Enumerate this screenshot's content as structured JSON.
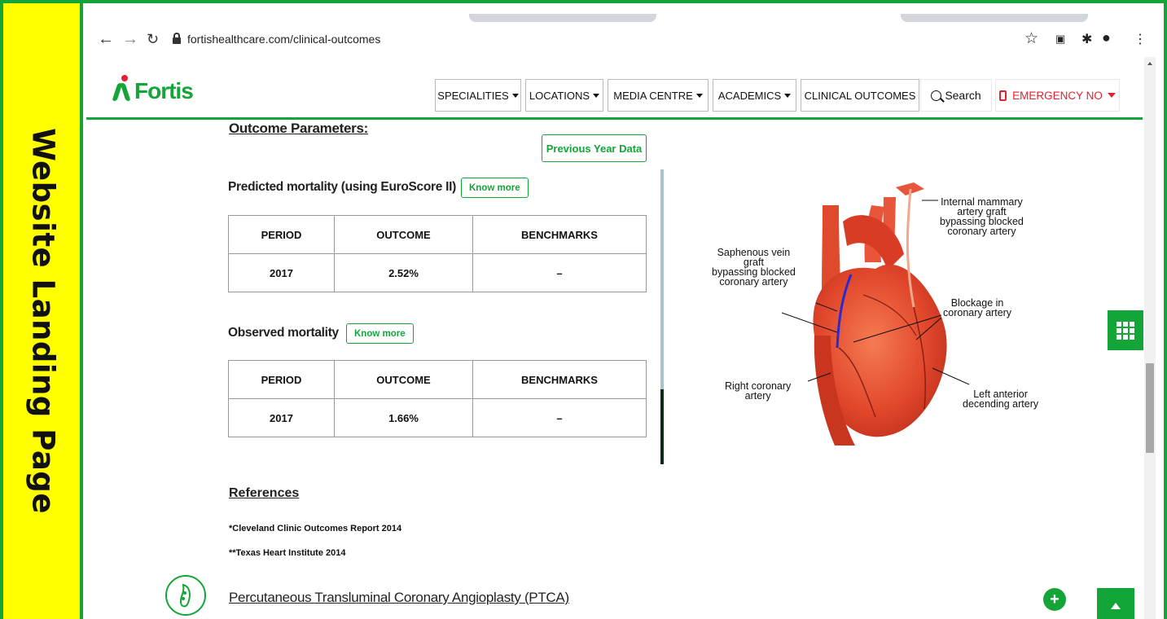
{
  "side_banner": {
    "text": "Website Landing Page"
  },
  "browser": {
    "url": "fortishealthcare.com/clinical-outcomes",
    "icons": [
      "back-arrow-icon",
      "forward-arrow-icon",
      "reload-icon",
      "lock-icon",
      "star-icon",
      "extension-icon",
      "puzzle-icon",
      "profile-icon",
      "more-vert-icon"
    ]
  },
  "site": {
    "logo_text": "Fortis",
    "nav": [
      "SPECIALITIES",
      "LOCATIONS",
      "MEDIA CENTRE",
      "ACADEMICS",
      "CLINICAL OUTCOMES"
    ],
    "search_label": "Search",
    "emergency_label": "EMERGENCY NO"
  },
  "content": {
    "section_title": "Outcome Parameters:",
    "prev_year_button": "Previous Year Data",
    "predicted": {
      "title": "Predicted mortality (using EuroScore II)",
      "know_more": "Know more",
      "headers": [
        "PERIOD",
        "OUTCOME",
        "BENCHMARKS"
      ],
      "rows": [
        [
          "2017",
          "2.52%",
          "–"
        ]
      ]
    },
    "observed": {
      "title": "Observed mortality",
      "know_more": "Know more",
      "headers": [
        "PERIOD",
        "OUTCOME",
        "BENCHMARKS"
      ],
      "rows": [
        [
          "2017",
          "1.66%",
          "–"
        ]
      ]
    },
    "references_title": "References",
    "references": [
      "*Cleveland Clinic Outcomes Report 2014",
      "**Texas Heart Institute 2014"
    ],
    "ptca_title": "Percutaneous Transluminal Coronary Angioplasty (PTCA)"
  },
  "figure": {
    "labels": {
      "mammary_1": "Internal mammary",
      "mammary_2": "artery graft",
      "mammary_3": "bypassing blocked",
      "mammary_4": "coronary artery",
      "saph_1": "Saphenous vein",
      "saph_2": "graft",
      "saph_3": "bypassing blocked",
      "saph_4": "coronary artery",
      "block_1": "Blockage in",
      "block_2": "coronary artery",
      "right_1": "Right coronary",
      "right_2": "artery",
      "lad_1": "Left anterior",
      "lad_2": "decending artery"
    }
  },
  "colors": {
    "brand_green": "#13a538",
    "emergency_red": "#e4222f",
    "banner_yellow": "#ffff00"
  }
}
